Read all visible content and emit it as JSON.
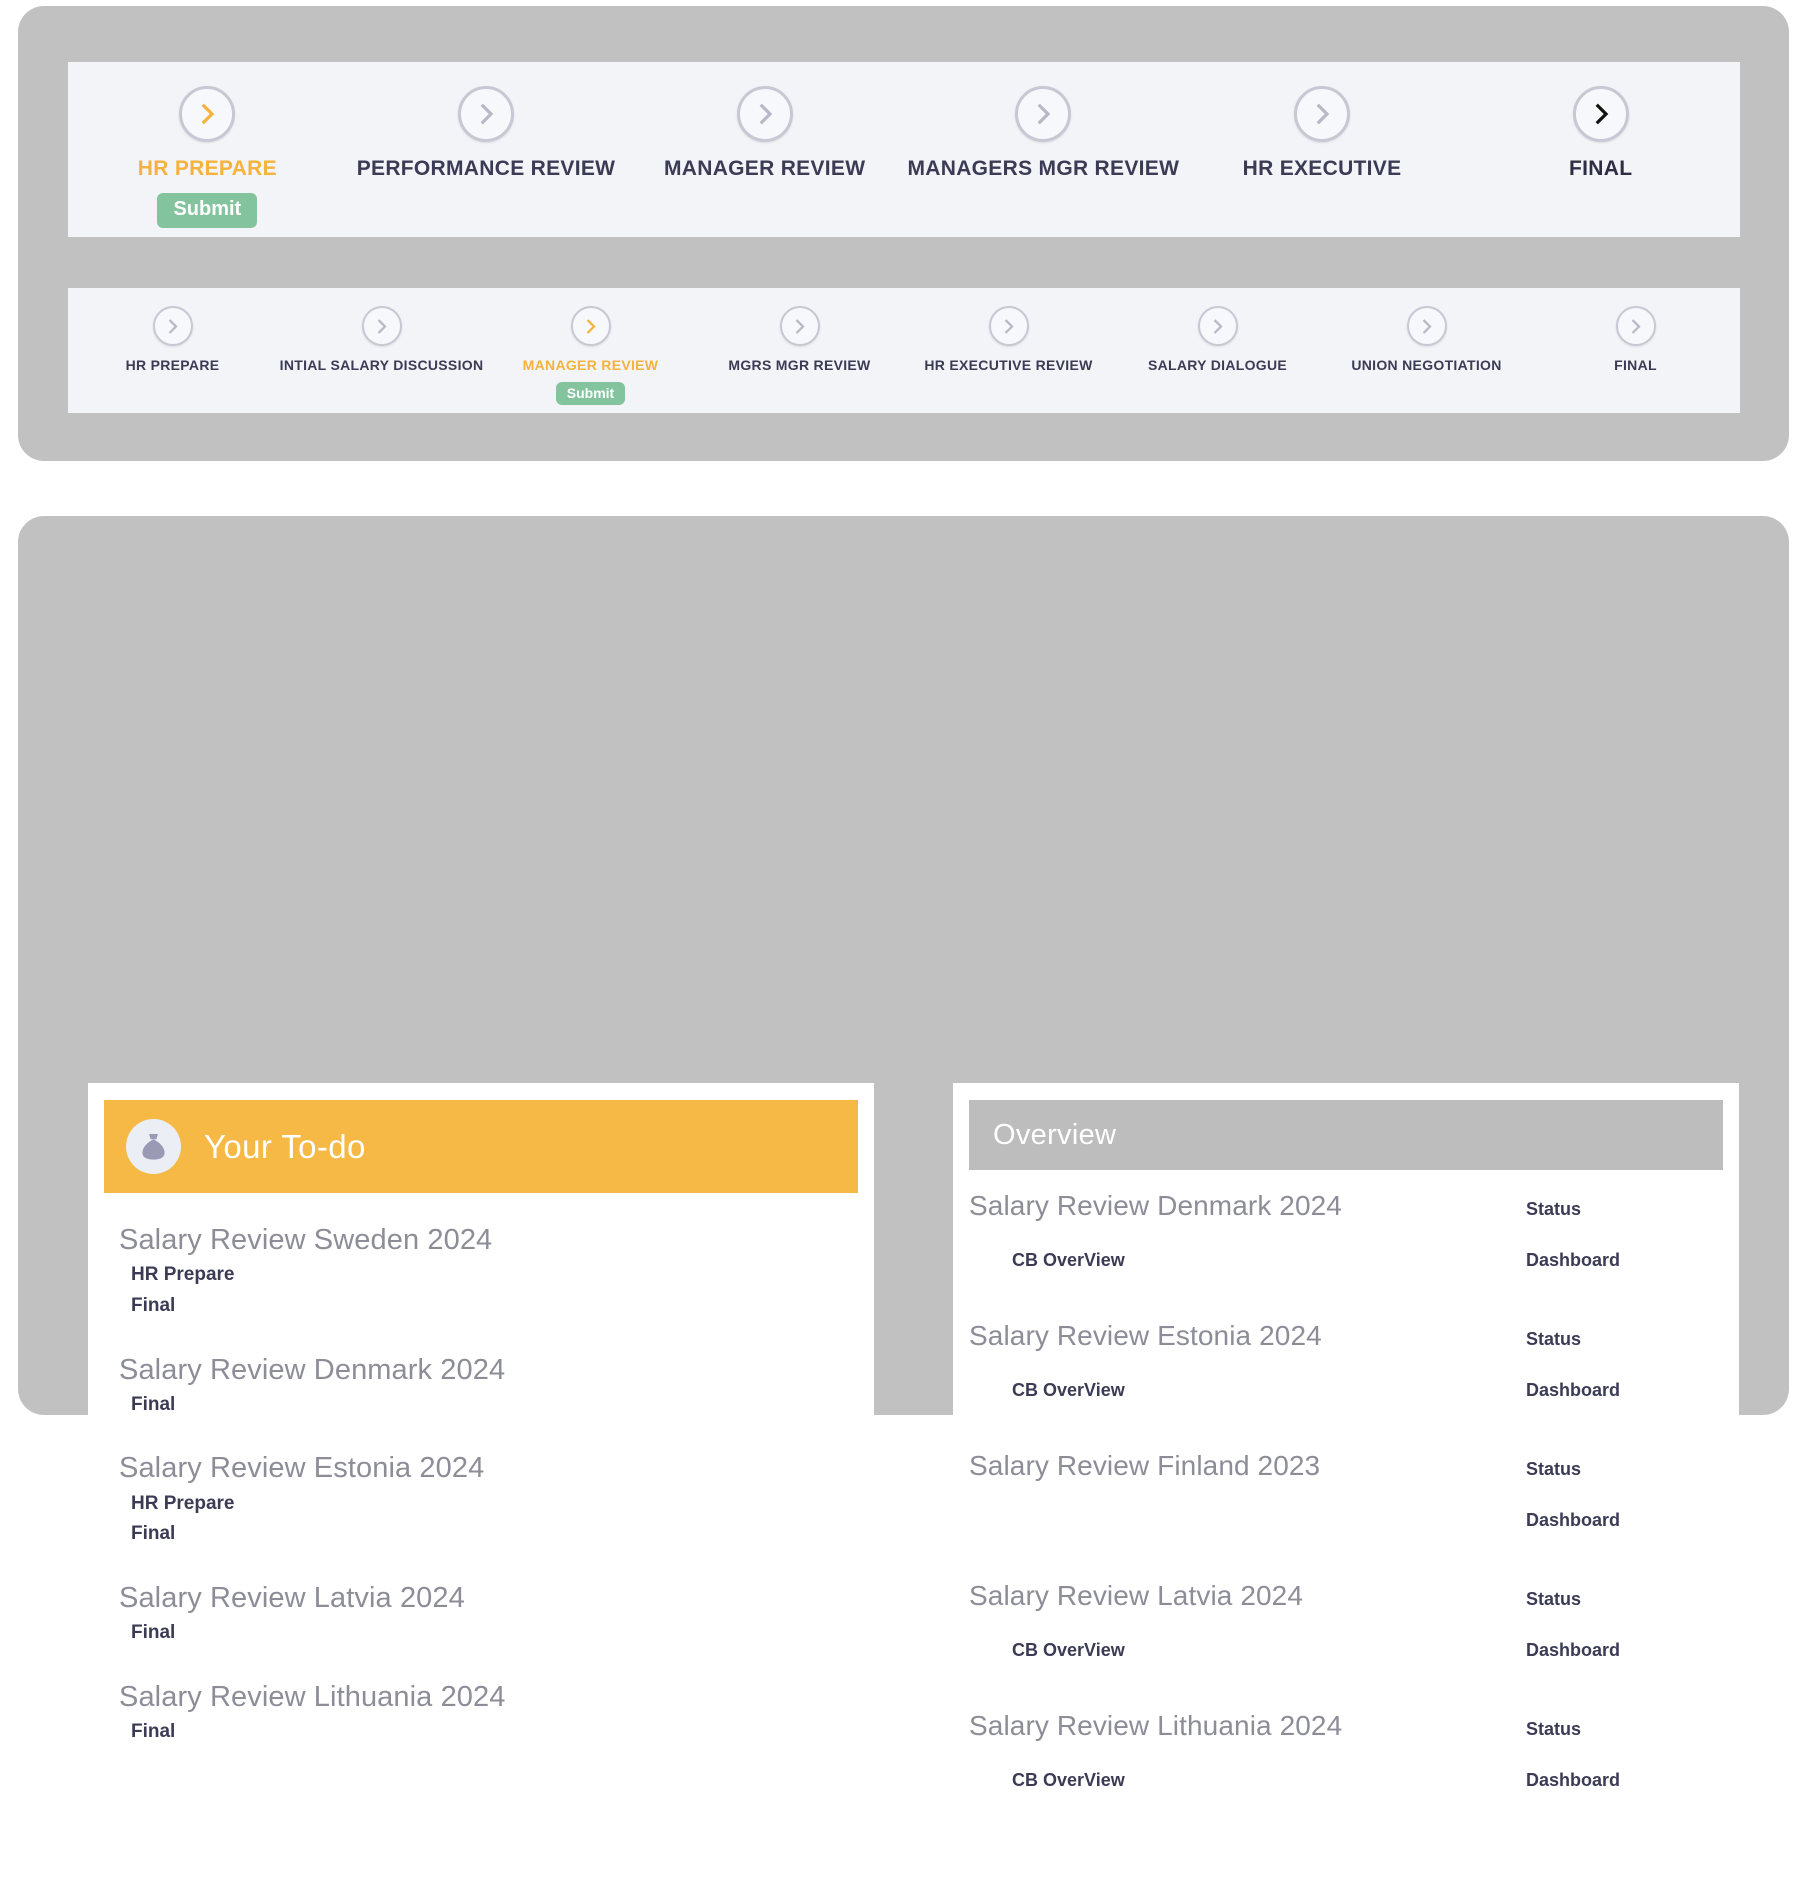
{
  "theme": {
    "page_background": "#ffffff",
    "card_gray": "#c1c1c1",
    "strip_background": "#f2f4f8",
    "accent_orange": "#f5b23e",
    "todo_header_orange": "#f6b945",
    "overview_header_gray": "#bdbdbd",
    "submit_green": "#83c49f",
    "label_dark": "#3b3b55",
    "title_gray": "#8d8d98",
    "circle_gray": "#c8c8d4",
    "final_black": "#111111"
  },
  "workflow": {
    "primary_stepper": {
      "steps": [
        {
          "label": "HR PREPARE",
          "state": "active",
          "icon": "chevron-right-circle-icon",
          "badge": "Submit"
        },
        {
          "label": "PERFORMANCE REVIEW",
          "state": "default",
          "icon": "chevron-right-circle-icon",
          "badge": null
        },
        {
          "label": "MANAGER REVIEW",
          "state": "default",
          "icon": "chevron-right-circle-icon",
          "badge": null
        },
        {
          "label": "MANAGERS MGR REVIEW",
          "state": "default",
          "icon": "chevron-right-circle-icon",
          "badge": null
        },
        {
          "label": "HR EXECUTIVE",
          "state": "default",
          "icon": "chevron-right-circle-icon",
          "badge": null
        },
        {
          "label": "FINAL",
          "state": "final",
          "icon": "chevron-right-circle-icon",
          "badge": null
        }
      ]
    },
    "secondary_stepper": {
      "steps": [
        {
          "label": "HR PREPARE",
          "state": "default",
          "icon": "chevron-right-circle-icon",
          "badge": null
        },
        {
          "label": "INTIAL SALARY DISCUSSION",
          "state": "default",
          "icon": "chevron-right-circle-icon",
          "badge": null
        },
        {
          "label": "MANAGER REVIEW",
          "state": "active",
          "icon": "chevron-right-circle-icon",
          "badge": "Submit"
        },
        {
          "label": "MGRS MGR REVIEW",
          "state": "default",
          "icon": "chevron-right-circle-icon",
          "badge": null
        },
        {
          "label": "HR EXECUTIVE REVIEW",
          "state": "default",
          "icon": "chevron-right-circle-icon",
          "badge": null
        },
        {
          "label": "SALARY DIALOGUE",
          "state": "default",
          "icon": "chevron-right-circle-icon",
          "badge": null
        },
        {
          "label": "UNION NEGOTIATION",
          "state": "default",
          "icon": "chevron-right-circle-icon",
          "badge": null
        },
        {
          "label": "FINAL",
          "state": "default",
          "icon": "chevron-right-circle-icon",
          "badge": null
        }
      ]
    }
  },
  "todo": {
    "title": "Your To-do",
    "icon": "money-bag-icon",
    "items": [
      {
        "title": "Salary Review Sweden 2024",
        "links": [
          "HR Prepare",
          "Final"
        ]
      },
      {
        "title": "Salary Review Denmark 2024",
        "links": [
          "Final"
        ]
      },
      {
        "title": "Salary Review Estonia 2024",
        "links": [
          "HR Prepare",
          "Final"
        ]
      },
      {
        "title": "Salary Review Latvia 2024",
        "links": [
          "Final"
        ]
      },
      {
        "title": "Salary Review Lithuania 2024",
        "links": [
          "Final"
        ]
      }
    ]
  },
  "overview": {
    "title": "Overview",
    "rows": [
      {
        "name": "Salary Review Denmark 2024",
        "status_label": "Status",
        "sub_link": "CB OverView",
        "dashboard_label": "Dashboard"
      },
      {
        "name": "Salary Review Estonia 2024",
        "status_label": "Status",
        "sub_link": "CB OverView",
        "dashboard_label": "Dashboard"
      },
      {
        "name": "Salary Review Finland 2023",
        "status_label": "Status",
        "sub_link": "",
        "dashboard_label": "Dashboard"
      },
      {
        "name": "Salary Review Latvia 2024",
        "status_label": "Status",
        "sub_link": "CB OverView",
        "dashboard_label": "Dashboard"
      },
      {
        "name": "Salary Review Lithuania 2024",
        "status_label": "Status",
        "sub_link": "CB OverView",
        "dashboard_label": "Dashboard"
      }
    ]
  }
}
